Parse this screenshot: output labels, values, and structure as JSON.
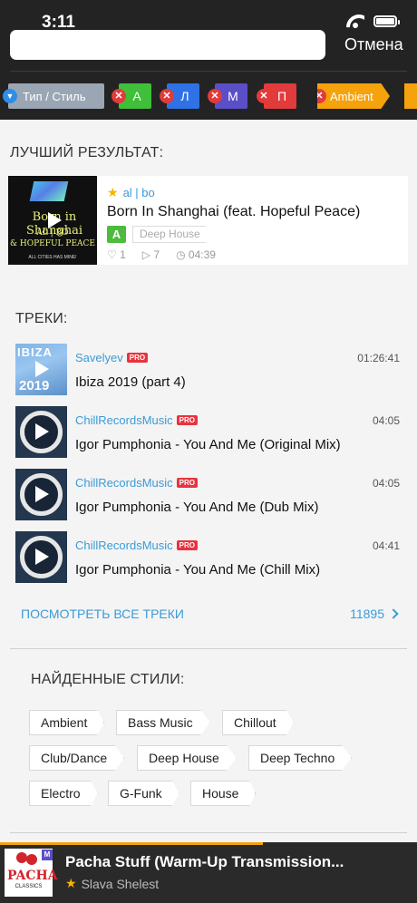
{
  "status_bar": {
    "time": "3:11"
  },
  "search": {
    "value": "",
    "placeholder": "",
    "cancel_label": "Отмена"
  },
  "filters": {
    "type_label": "Тип / Стиль",
    "chips": [
      {
        "label": "A",
        "color": "#3fbf3a"
      },
      {
        "label": "Л",
        "color": "#2e72e6"
      },
      {
        "label": "M",
        "color": "#5b4fc8"
      },
      {
        "label": "П",
        "color": "#e23b3b"
      }
    ],
    "style_chip": "Ambient"
  },
  "best_result": {
    "section_title": "ЛУЧШИЙ РЕЗУЛЬТАТ:",
    "artist": "al | bo",
    "title": "Born In Shanghai (feat. Hopeful Peace)",
    "cover": {
      "title": "Born in Shanghai",
      "line1": "AL | BO",
      "line2": "& HOPEFUL PEACE",
      "tiny": "ALL CITIES HAS MINE!"
    },
    "key": "A",
    "style": "Deep House",
    "likes": "1",
    "plays": "7",
    "duration": "04:39"
  },
  "tracks": {
    "section_title": "ТРЕКИ:",
    "items": [
      {
        "artist": "Savelyev",
        "badge": "PRO",
        "duration": "01:26:41",
        "title": "Ibiza 2019 (part 4)",
        "thumb_text": "IBIZA",
        "thumb_year": "2019"
      },
      {
        "artist": "ChillRecordsMusic",
        "badge": "PRO",
        "duration": "04:05",
        "title": "Igor Pumphonia - You And Me (Original Mix)"
      },
      {
        "artist": "ChillRecordsMusic",
        "badge": "PRO",
        "duration": "04:05",
        "title": "Igor Pumphonia - You And Me (Dub Mix)"
      },
      {
        "artist": "ChillRecordsMusic",
        "badge": "PRO",
        "duration": "04:41",
        "title": "Igor Pumphonia - You And Me (Chill Mix)"
      }
    ],
    "see_all_label": "ПОСМОТРЕТЬ ВСЕ ТРЕКИ",
    "total_count": "11895"
  },
  "styles_found": {
    "section_title": "НАЙДЕННЫЕ СТИЛИ:",
    "tags": [
      "Ambient",
      "Bass Music",
      "Chillout",
      "Club/Dance",
      "Deep House",
      "Deep Techno",
      "Electro",
      "G-Funk",
      "House"
    ]
  },
  "player": {
    "title": "Pacha Stuff (Warm-Up Transmission...",
    "artist": "Slava Shelest",
    "badge": "M",
    "cover_text": "PACHA",
    "cover_sub": "CLASSICS",
    "progress": 0.63
  },
  "colors": {
    "accent": "#3a9bd7",
    "header_bg": "#232323",
    "player_progress": "#f5a20c"
  }
}
